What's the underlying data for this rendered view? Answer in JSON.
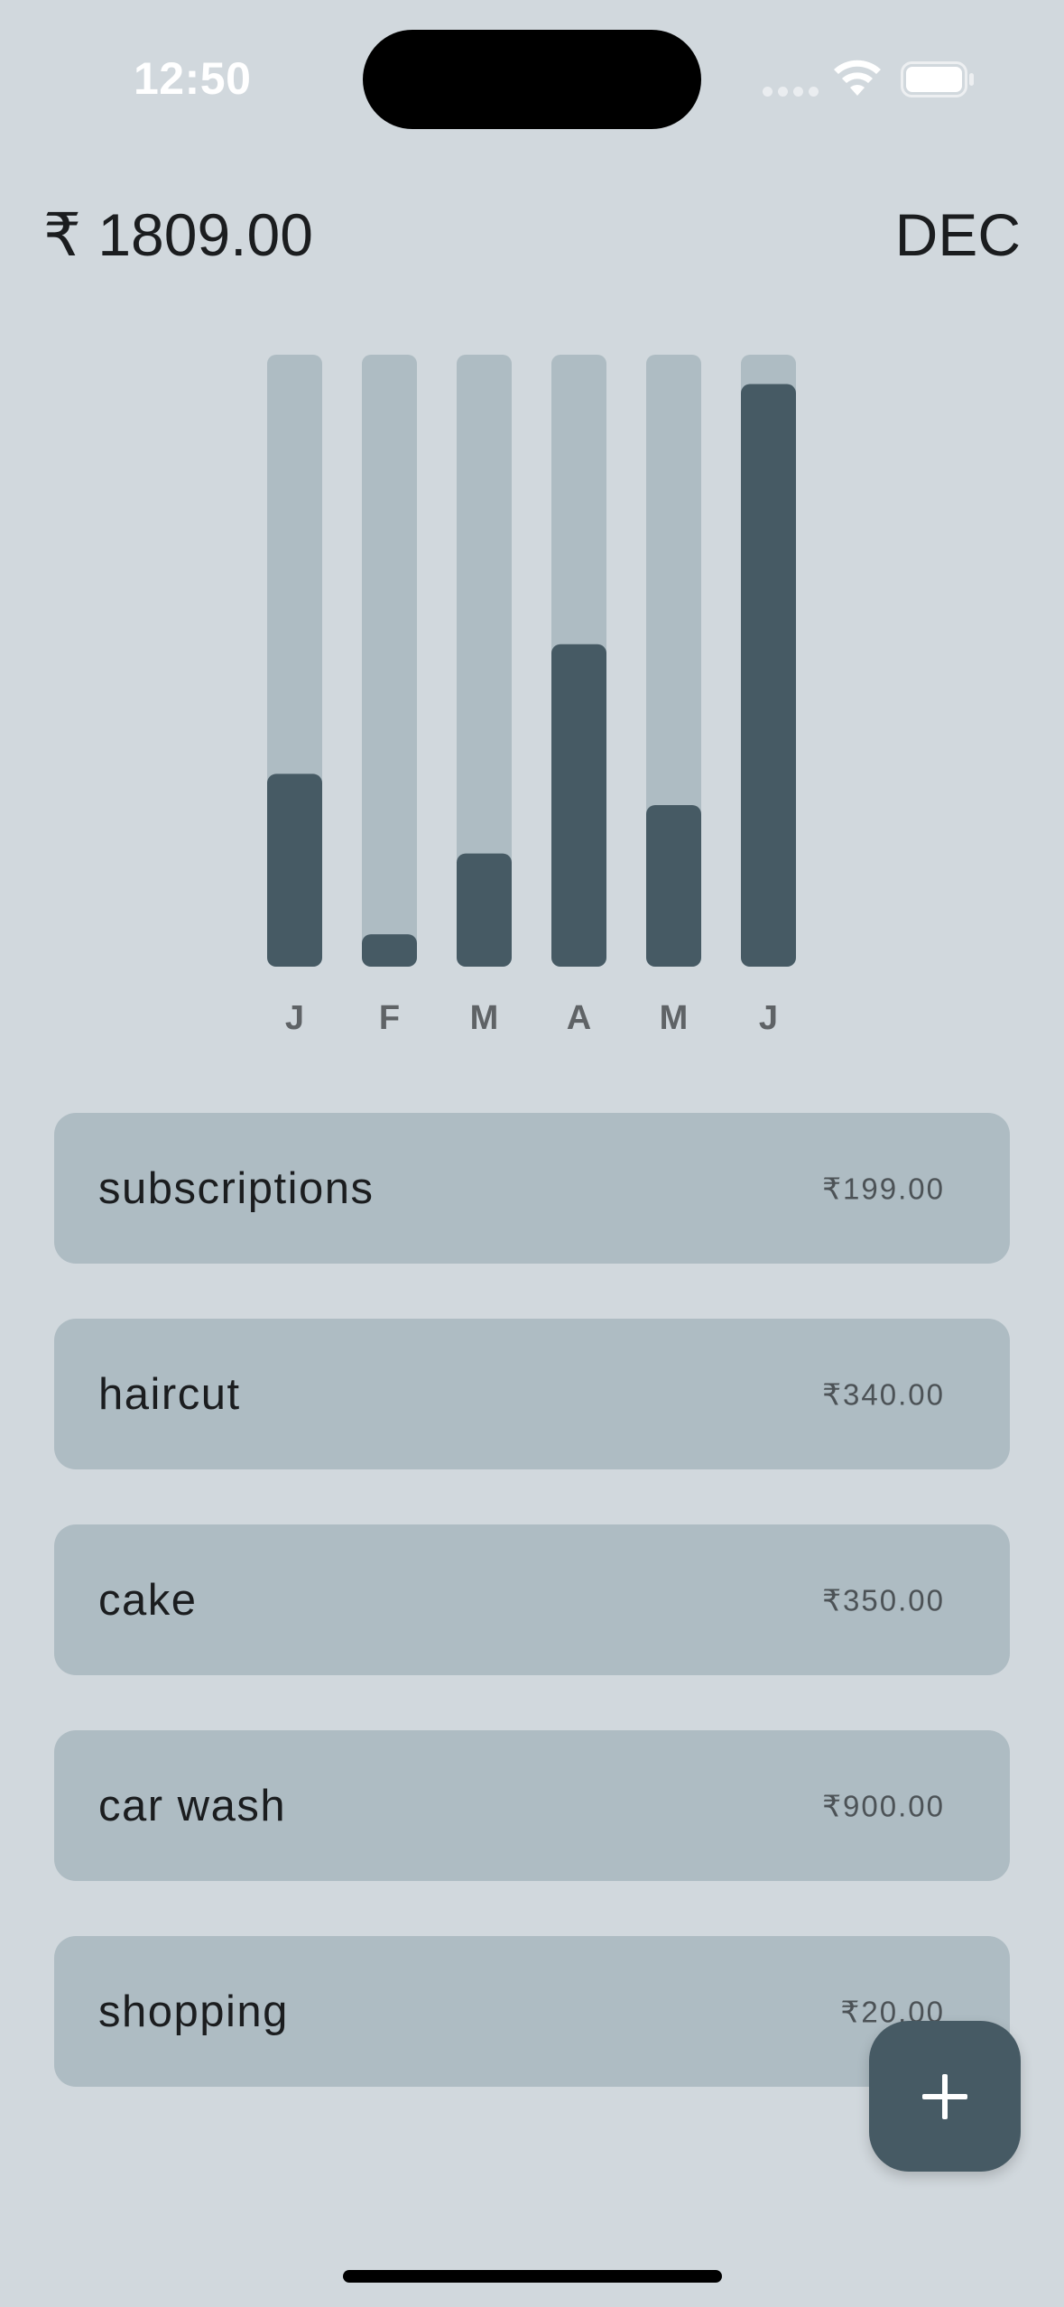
{
  "status_bar": {
    "time": "12:50"
  },
  "header": {
    "total": "₹ 1809.00",
    "month": "DEC"
  },
  "chart_data": {
    "type": "bar",
    "categories": [
      "J",
      "F",
      "M",
      "A",
      "M",
      "J"
    ],
    "values": [
      0.315,
      0.053,
      0.185,
      0.527,
      0.264,
      0.952
    ],
    "ylim": [
      0,
      1
    ],
    "grid": false
  },
  "expenses": [
    {
      "name": "subscriptions",
      "amount": "₹199.00"
    },
    {
      "name": "haircut",
      "amount": "₹340.00"
    },
    {
      "name": "cake",
      "amount": "₹350.00"
    },
    {
      "name": "car wash",
      "amount": "₹900.00"
    },
    {
      "name": "shopping",
      "amount": "₹20.00"
    }
  ],
  "colors": {
    "background": "#d1d8dd",
    "track": "#aebcc3",
    "accent": "#465a64"
  },
  "icons": {
    "fab": "plus-icon",
    "wifi": "wifi-icon",
    "battery": "battery-icon"
  }
}
